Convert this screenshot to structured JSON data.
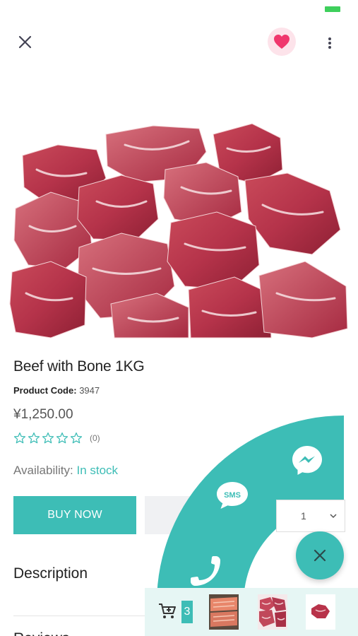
{
  "header": {
    "close_icon": "close-icon",
    "favorite_icon": "heart-icon",
    "more_icon": "more-vertical-icon"
  },
  "product": {
    "title": "Beef with Bone 1KG",
    "code_label": "Product Code:",
    "code_value": "3947",
    "price": "¥1,250.00",
    "rating_stars": 0,
    "rating_max": 5,
    "review_count": "(0)",
    "availability_label": "Availability:",
    "availability_value": "In stock"
  },
  "actions": {
    "buy_now_label": "BUY NOW",
    "quantity_value": "1"
  },
  "sections": {
    "description_label": "Description",
    "reviews_label": "Reviews"
  },
  "contact_menu": {
    "messenger_icon": "messenger-icon",
    "sms_label": "SMS",
    "phone_icon": "phone-icon",
    "close_icon": "close-icon"
  },
  "cart_bar": {
    "cart_icon": "cart-add-icon",
    "count": "3",
    "thumbnails": [
      "salmon-fillet-thumbnail",
      "beef-chunks-thumbnail",
      "red-meat-thumbnail"
    ]
  },
  "colors": {
    "accent": "#3dbdb6",
    "heart": "#f0376d",
    "heart_bg": "#fde3ea",
    "cart_bar_bg": "#e6f6f4"
  }
}
